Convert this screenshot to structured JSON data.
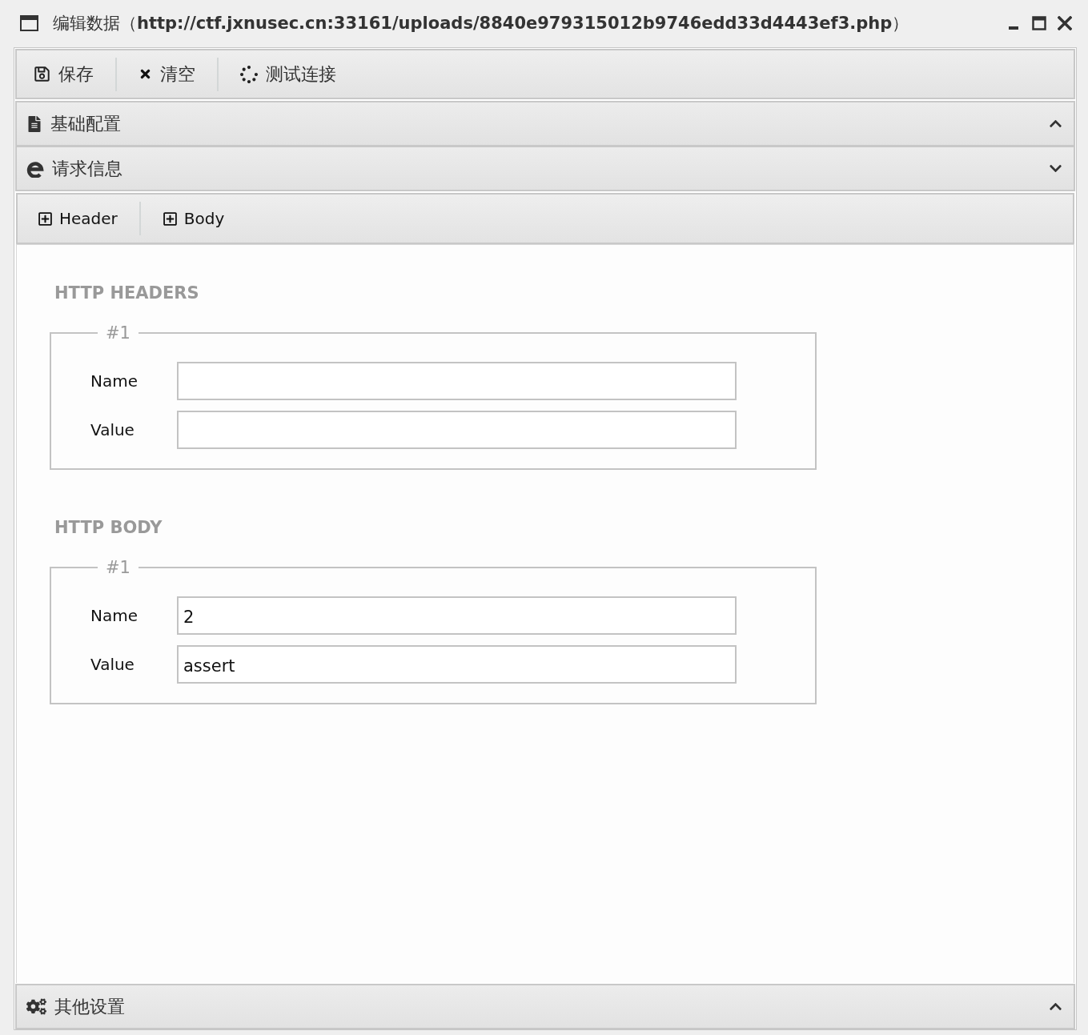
{
  "window": {
    "title": "编辑数据（**http://ctf.jxnusec.cn:33161/uploads/8840e979315012b9746edd33d4443ef3.php**）",
    "controls": [
      {
        "kind": "minimize"
      },
      {
        "kind": "maximize"
      },
      {
        "kind": "close"
      }
    ]
  },
  "toolbar": [
    {
      "kind": "save",
      "label": "保存"
    },
    {
      "kind": "clear",
      "label": "清空"
    },
    {
      "kind": "test",
      "label": "测试连接"
    }
  ],
  "panels": [
    {
      "kind": "document",
      "title": "基础配置",
      "expanded": false
    },
    {
      "kind": "request",
      "title": "请求信息",
      "expanded": true,
      "content": {
        "buttons": [
          {
            "label": "Header"
          },
          {
            "label": "Body"
          }
        ],
        "sections": [
          {
            "heading": "HTTP HEADERS",
            "groups": [
              {
                "legend": "#1",
                "fields": [
                  {
                    "label": "Name"
                  },
                  {
                    "label": "Value"
                  }
                ]
              }
            ]
          },
          {
            "heading": "HTTP BODY",
            "groups": [
              {
                "legend": "#1",
                "fields": [
                  {
                    "label": "Name",
                    "value": "2"
                  },
                  {
                    "label": "Value",
                    "value": "assert"
                  }
                ]
              }
            ]
          }
        ]
      }
    },
    {
      "kind": "settings",
      "title": "其他设置",
      "expanded": false
    }
  ]
}
